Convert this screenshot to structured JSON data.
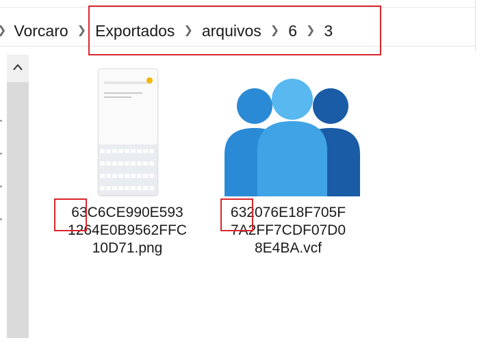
{
  "breadcrumb": {
    "items": [
      "Vorcaro",
      "Exportados",
      "arquivos",
      "6",
      "3"
    ]
  },
  "files": [
    {
      "name_lines": [
        "63C6CE990E593",
        "1264E0B9562FFC",
        "10D71.png"
      ],
      "type": "png",
      "icon": "phone-screenshot-thumbnail"
    },
    {
      "name_lines": [
        "632076E18F705F",
        "7A2FF7CDF07D0",
        "8E4BA.vcf"
      ],
      "type": "vcf",
      "icon": "contacts-people-icon"
    }
  ],
  "colors": {
    "highlight": "#d9262b",
    "contact_dark": "#1a5ca6",
    "contact_mid": "#2b8ad6",
    "contact_light": "#58b8ef"
  }
}
